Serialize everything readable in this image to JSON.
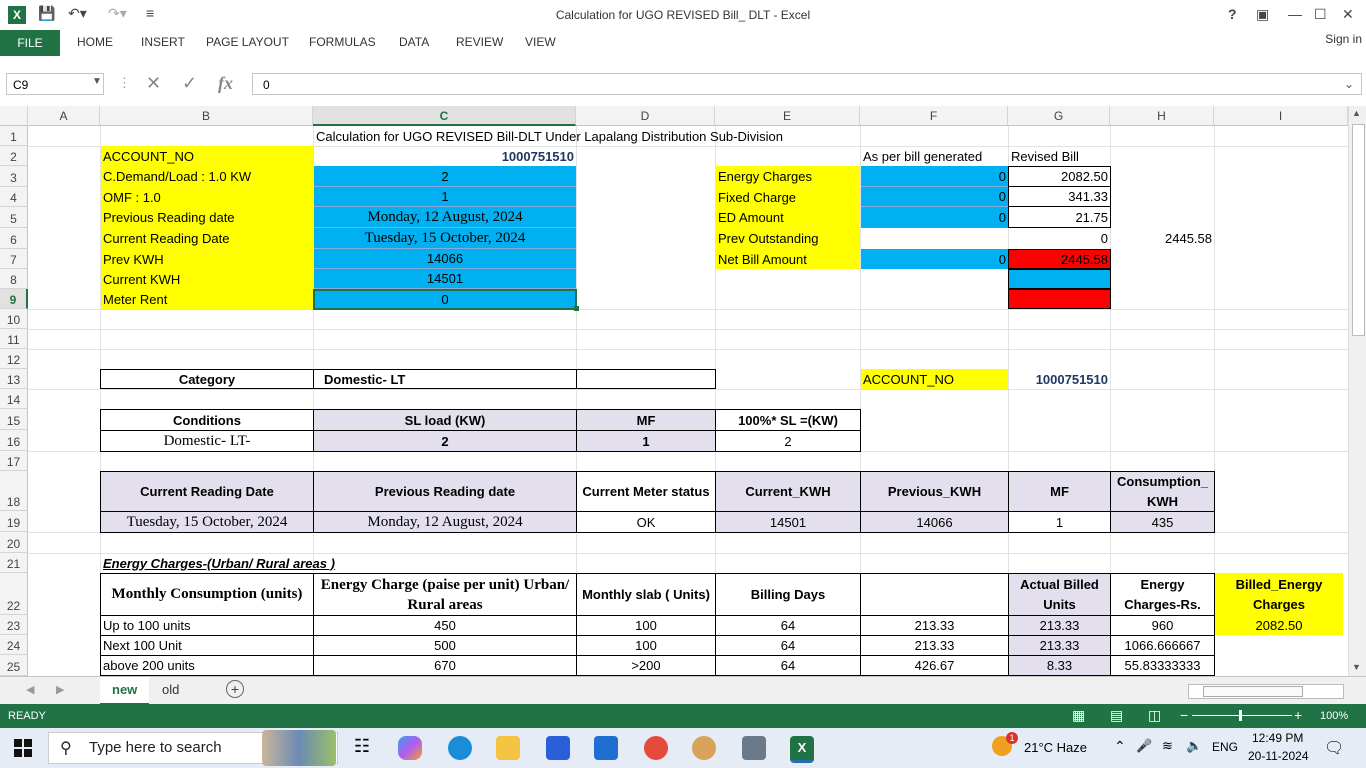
{
  "window": {
    "title": "Calculation for UGO REVISED Bill_ DLT - Excel",
    "help": "?",
    "signin": "Sign in"
  },
  "ribbon": {
    "tabs": [
      "FILE",
      "HOME",
      "INSERT",
      "PAGE LAYOUT",
      "FORMULAS",
      "DATA",
      "REVIEW",
      "VIEW"
    ]
  },
  "formula_bar": {
    "name_box": "C9",
    "value": "0",
    "fx": "fx"
  },
  "columns": [
    "A",
    "B",
    "C",
    "D",
    "E",
    "F",
    "G",
    "H",
    "I"
  ],
  "rows": [
    "1",
    "2",
    "3",
    "4",
    "5",
    "6",
    "7",
    "8",
    "9",
    "10",
    "11",
    "12",
    "13",
    "14",
    "15",
    "16",
    "17",
    "18",
    "19",
    "20",
    "21",
    "22",
    "23",
    "24",
    "25"
  ],
  "sheet": {
    "r1": {
      "title": "Calculation for UGO REVISED Bill-DLT Under Lapalang Distribution Sub-Division"
    },
    "left_labels": [
      "ACCOUNT_NO",
      "C.Demand/Load : 1.0 KW",
      "OMF : 1.0",
      "Previous Reading date",
      "Current Reading Date",
      "Prev KWH",
      "Current KWH",
      "Meter Rent"
    ],
    "left_values": [
      "1000751510",
      "2",
      "1",
      "Monday, 12 August, 2024",
      "Tuesday, 15 October, 2024",
      "14066",
      "14501",
      "0"
    ],
    "right_header": {
      "f": "As per bill generated",
      "g": "Revised Bill"
    },
    "right_labels": [
      "Energy Charges",
      "Fixed Charge",
      "ED Amount",
      "Prev Outstanding",
      "Net Bill Amount"
    ],
    "right_f": [
      "0",
      "0",
      "0",
      "",
      "0"
    ],
    "right_g": [
      "2082.50",
      "341.33",
      "21.75",
      "0",
      "2445.58"
    ],
    "h6": "2445.58",
    "r13": {
      "category_label": "Category",
      "category_value": "Domestic- LT",
      "acct_label": "ACCOUNT_NO",
      "acct_value": "1000751510"
    },
    "r15": [
      "Conditions",
      "SL load (KW)",
      "MF",
      "100%* SL =(KW)"
    ],
    "r16": [
      "Domestic- LT-",
      "2",
      "1",
      "2"
    ],
    "r18": [
      "Current Reading Date",
      "Previous Reading date",
      "Current Meter status",
      "Current_KWH",
      "Previous_KWH",
      "MF",
      "Consumption_KWH"
    ],
    "r19": [
      "Tuesday, 15 October, 2024",
      "Monday, 12 August, 2024",
      "OK",
      "14501",
      "14066",
      "1",
      "435"
    ],
    "r21": "Energy Charges-(Urban/ Rural areas )",
    "r22": [
      "Monthly Consumption (units)",
      "Energy Charge (paise per unit)  Urban/ Rural areas",
      "Monthly slab ( Units)",
      "Billing Days",
      "",
      "Actual Billed Units",
      "Energy Charges-Rs.",
      "Billed_Energy Charges"
    ],
    "r23": [
      "Up to 100 units",
      "450",
      "100",
      "64",
      "213.33",
      "213.33",
      "960",
      "2082.50"
    ],
    "r24": [
      "Next 100 Unit",
      "500",
      "100",
      "64",
      "213.33",
      "213.33",
      "1066.666667",
      ""
    ],
    "r25": [
      "above 200 units",
      "670",
      ">200",
      "64",
      "426.67",
      "8.33",
      "55.83333333",
      ""
    ]
  },
  "sheet_tabs": [
    "new",
    "old"
  ],
  "status": {
    "ready": "READY",
    "zoom": "100%"
  },
  "taskbar": {
    "search_placeholder": "Type here to search",
    "weather": "21°C  Haze",
    "lang": "ENG",
    "time": "12:49 PM",
    "date": "20-11-2024",
    "badge": "1"
  }
}
